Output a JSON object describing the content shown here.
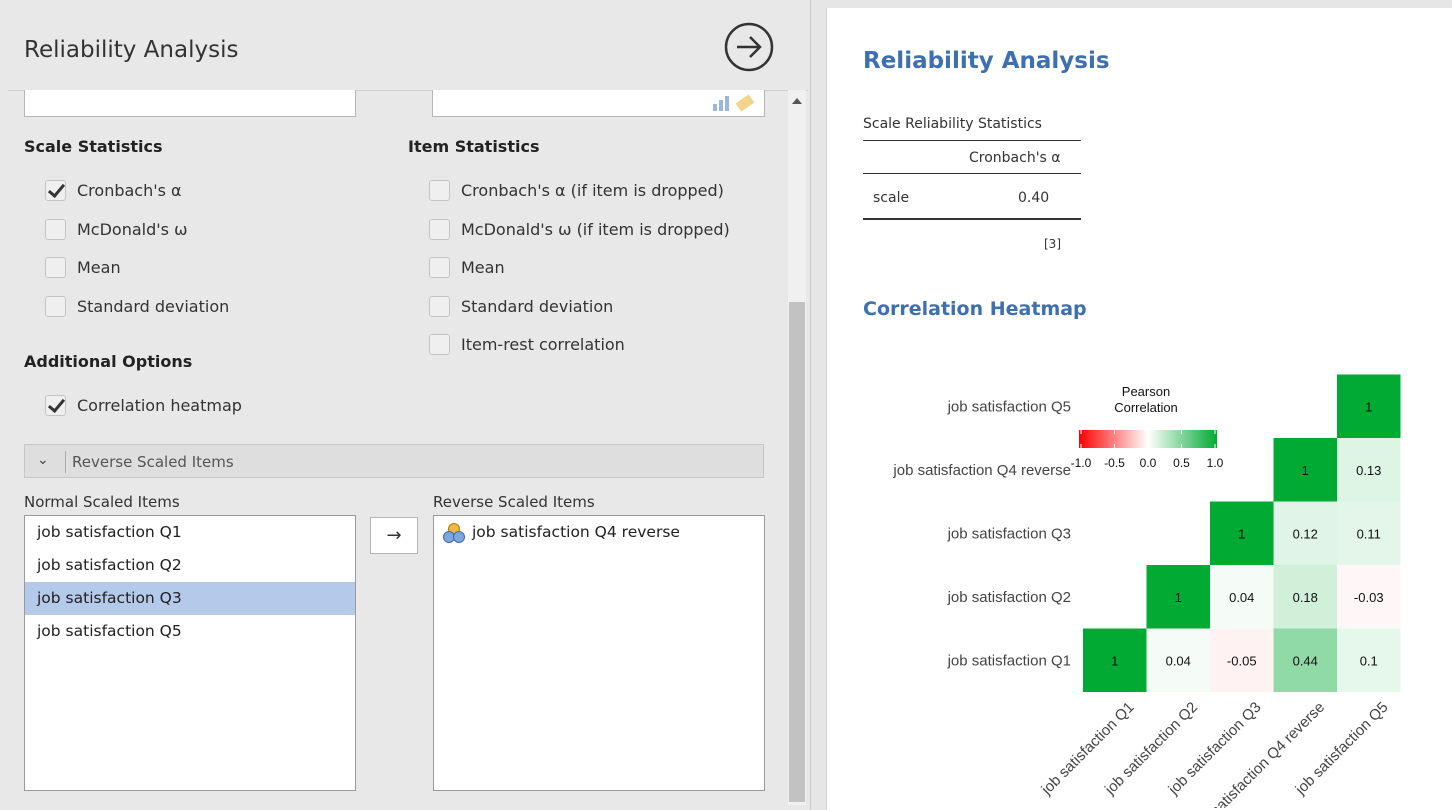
{
  "header": {
    "title": "Reliability Analysis"
  },
  "scale_statistics": {
    "title": "Scale Statistics",
    "options": [
      {
        "label": "Cronbach's α",
        "checked": true
      },
      {
        "label": "McDonald's ω",
        "checked": false
      },
      {
        "label": "Mean",
        "checked": false
      },
      {
        "label": "Standard deviation",
        "checked": false
      }
    ]
  },
  "item_statistics": {
    "title": "Item Statistics",
    "options": [
      {
        "label": "Cronbach's α (if item is dropped)",
        "checked": false
      },
      {
        "label": "McDonald's ω (if item is dropped)",
        "checked": false
      },
      {
        "label": "Mean",
        "checked": false
      },
      {
        "label": "Standard deviation",
        "checked": false
      },
      {
        "label": "Item-rest correlation",
        "checked": false
      }
    ]
  },
  "additional_options": {
    "title": "Additional Options",
    "options": [
      {
        "label": "Correlation heatmap",
        "checked": true
      }
    ]
  },
  "reverse_section": {
    "title": "Reverse Scaled Items",
    "normal_label": "Normal Scaled Items",
    "reverse_label": "Reverse Scaled Items",
    "normal_items": [
      "job satisfaction Q1",
      "job satisfaction Q2",
      "job satisfaction Q3",
      "job satisfaction Q5"
    ],
    "selected_index": 2,
    "reverse_items": [
      "job satisfaction Q4 reverse"
    ],
    "move_button": "→"
  },
  "results": {
    "title": "Reliability Analysis",
    "table": {
      "caption": "Scale Reliability Statistics",
      "column": "Cronbach's α",
      "row_label": "scale",
      "value": "0.40",
      "footnote": "[3]"
    },
    "heatmap_title": "Correlation Heatmap"
  },
  "chart_data": {
    "type": "heatmap",
    "title": "",
    "variables": [
      "job satisfaction Q1",
      "job satisfaction Q2",
      "job satisfaction Q3",
      "job satisfaction Q4 reverse",
      "job satisfaction Q5"
    ],
    "cells": [
      {
        "row": "job satisfaction Q5",
        "col": "job satisfaction Q5",
        "value": 1,
        "label": "1"
      },
      {
        "row": "job satisfaction Q4 reverse",
        "col": "job satisfaction Q4 reverse",
        "value": 1,
        "label": "1"
      },
      {
        "row": "job satisfaction Q4 reverse",
        "col": "job satisfaction Q5",
        "value": 0.13,
        "label": "0.13"
      },
      {
        "row": "job satisfaction Q3",
        "col": "job satisfaction Q3",
        "value": 1,
        "label": "1"
      },
      {
        "row": "job satisfaction Q3",
        "col": "job satisfaction Q4 reverse",
        "value": 0.12,
        "label": "0.12"
      },
      {
        "row": "job satisfaction Q3",
        "col": "job satisfaction Q5",
        "value": 0.11,
        "label": "0.11"
      },
      {
        "row": "job satisfaction Q2",
        "col": "job satisfaction Q2",
        "value": 1,
        "label": "1"
      },
      {
        "row": "job satisfaction Q2",
        "col": "job satisfaction Q3",
        "value": 0.04,
        "label": "0.04"
      },
      {
        "row": "job satisfaction Q2",
        "col": "job satisfaction Q4 reverse",
        "value": 0.18,
        "label": "0.18"
      },
      {
        "row": "job satisfaction Q2",
        "col": "job satisfaction Q5",
        "value": -0.03,
        "label": "-0.03"
      },
      {
        "row": "job satisfaction Q1",
        "col": "job satisfaction Q1",
        "value": 1,
        "label": "1"
      },
      {
        "row": "job satisfaction Q1",
        "col": "job satisfaction Q2",
        "value": 0.04,
        "label": "0.04"
      },
      {
        "row": "job satisfaction Q1",
        "col": "job satisfaction Q3",
        "value": -0.05,
        "label": "-0.05"
      },
      {
        "row": "job satisfaction Q1",
        "col": "job satisfaction Q4 reverse",
        "value": 0.44,
        "label": "0.44"
      },
      {
        "row": "job satisfaction Q1",
        "col": "job satisfaction Q5",
        "value": 0.1,
        "label": "0.1"
      }
    ],
    "legend": {
      "title_lines": [
        "Pearson",
        "Correlation"
      ],
      "ticks": [
        "-1.0",
        "-0.5",
        "0.0",
        "0.5",
        "1.0"
      ],
      "range": [
        -1,
        1
      ],
      "placement": "top-left",
      "colors": {
        "negative": "#ff0000",
        "zero": "#ffffff",
        "positive": "#00aa33"
      }
    }
  },
  "colors": {
    "accent": "#3e6fb0",
    "selection": "#b5c9ea"
  }
}
